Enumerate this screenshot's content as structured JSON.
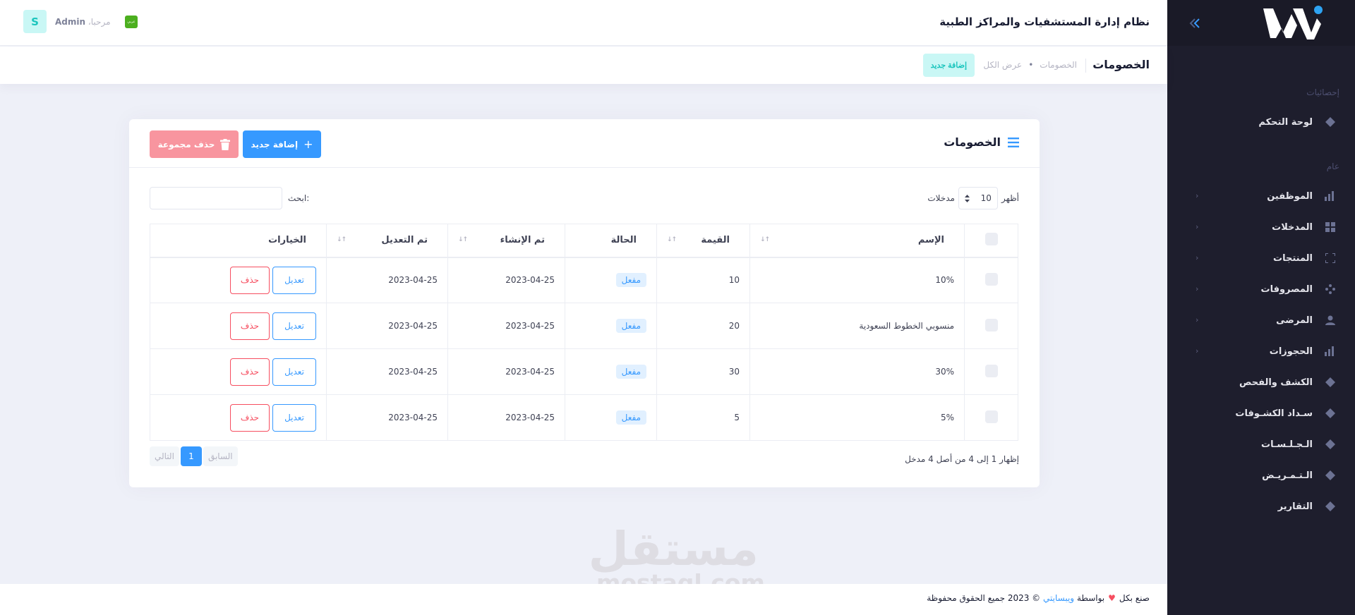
{
  "app": {
    "system_title": "نظام إدارة المستشفيات والمراكز الطبية",
    "user_greeting": "مرحبا،",
    "user_name": "Admin",
    "user_initial": "S",
    "flag_text": "عربي"
  },
  "sidebar": {
    "section_stats": "إحصائيات",
    "section_general": "عام",
    "dashboard": "لوحة التحكم",
    "items": [
      {
        "label": "الموظفين"
      },
      {
        "label": "المدخلات"
      },
      {
        "label": "المنتجات"
      },
      {
        "label": "المصروفات"
      },
      {
        "label": "المرضى"
      },
      {
        "label": "الحجوزات"
      },
      {
        "label": "الكشف والفحص"
      },
      {
        "label": "سـداد الكشـوفات"
      },
      {
        "label": "الـجـلـسـات"
      },
      {
        "label": "الـتـمـريـض"
      },
      {
        "label": "التقارير"
      }
    ]
  },
  "subheader": {
    "title": "الخصومات",
    "crumb_1": "الخصومات",
    "crumb_2": "عرض الكل",
    "add_button": "إضافة جديد"
  },
  "card": {
    "title": "الخصومات",
    "add_button": "إضافة جديد",
    "bulk_delete_button": "حذف مجموعة",
    "show_label": "أظهر",
    "entries_label": "مدخلات",
    "page_length": "10",
    "search_label": "ابحث:",
    "columns": [
      "الإسم",
      "القيمة",
      "الحالة",
      "تم الإنشاء",
      "تم التعديل",
      "الخيارات"
    ],
    "rows": [
      {
        "name": "10%",
        "value": "10",
        "status": "مفعل",
        "created": "2023-04-25",
        "updated": "2023-04-25"
      },
      {
        "name": "منسوبي الخطوط السعودية",
        "value": "20",
        "status": "مفعل",
        "created": "2023-04-25",
        "updated": "2023-04-25"
      },
      {
        "name": "30%",
        "value": "30",
        "status": "مفعل",
        "created": "2023-04-25",
        "updated": "2023-04-25"
      },
      {
        "name": "5%",
        "value": "5",
        "status": "مفعل",
        "created": "2023-04-25",
        "updated": "2023-04-25"
      }
    ],
    "edit_label": "تعديل",
    "delete_label": "حذف",
    "info": "إظهار 1 إلى 4 من أصل 4 مدخل",
    "pager": {
      "prev": "السابق",
      "current": "1",
      "next": "التالي"
    }
  },
  "watermark": {
    "ar": "مستقل",
    "en": "mostaql.com"
  },
  "footer": {
    "prefix": "صنع بكل",
    "by": "بواسطة",
    "brand": "ويبسايتي",
    "suffix": "© 2023 جميع الحقوق محفوظة"
  },
  "colors": {
    "sidebar_bg": "#1e1e2d",
    "primary": "#3699ff",
    "danger": "#f64e60",
    "info_light": "#c9f7f5",
    "info": "#1bc5bd",
    "page_bg": "#eef0f8"
  }
}
